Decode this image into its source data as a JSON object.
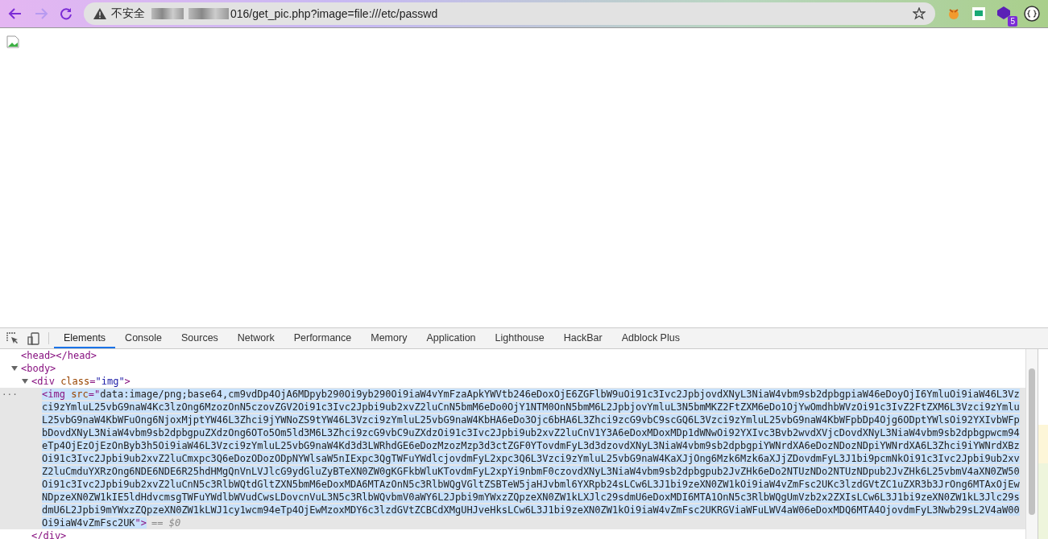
{
  "browser": {
    "security_label": "不安全",
    "url_visible": "016/get_pic.php?image=file:///etc/passwd",
    "extension_badge": "5"
  },
  "devtools": {
    "tabs": [
      {
        "label": "Elements",
        "selected": true
      },
      {
        "label": "Console",
        "selected": false
      },
      {
        "label": "Sources",
        "selected": false
      },
      {
        "label": "Network",
        "selected": false
      },
      {
        "label": "Performance",
        "selected": false
      },
      {
        "label": "Memory",
        "selected": false
      },
      {
        "label": "Application",
        "selected": false
      },
      {
        "label": "Lighthouse",
        "selected": false
      },
      {
        "label": "HackBar",
        "selected": false
      },
      {
        "label": "Adblock Plus",
        "selected": false
      }
    ],
    "dom_tree": [
      {
        "selected": false,
        "segments": [
          {
            "kind": "tag",
            "text": "<head></head>"
          }
        ]
      },
      {
        "selected": false,
        "expanded": true,
        "segments": [
          {
            "kind": "tag",
            "text": "<body>"
          }
        ],
        "children": [
          {
            "selected": false,
            "expanded": true,
            "segments": [
              {
                "kind": "tag",
                "text": "<div "
              },
              {
                "kind": "attr",
                "text": "class"
              },
              {
                "kind": "tag",
                "text": "="
              },
              {
                "kind": "value",
                "text": "\"img\""
              },
              {
                "kind": "tag",
                "text": ">"
              }
            ],
            "closing": "</div>",
            "children": [
              {
                "selected": true,
                "gutter": "...",
                "segments": [
                  {
                    "kind": "tag",
                    "text": "<img "
                  },
                  {
                    "kind": "attr",
                    "text": "src"
                  },
                  {
                    "kind": "tag",
                    "text": "=\""
                  },
                  {
                    "kind": "value",
                    "text": "data:image/png;base64,cm9vdDp4OjA6MDpyb290Oi9yb290Oi9iaW4vYmFzaApkYWVtb246eDoxOjE6ZGFlbW9uOi91c3Ivc2JpbjovdXNyL3NiaW4vbm9sb2dpbgpiaW46eDoyOjI6YmluOi9iaW46L3Vzci9zYmluL25vbG9naW4Kc3lzOng6MzozOnN5czovZGV2Oi91c3Ivc2Jpbi9ub2xvZ2luCnN5bmM6eDo0OjY1NTM0OnN5bmM6L2JpbjovYmluL3N5bmMKZ2FtZXM6eDo1OjYwOmdhbWVzOi91c3IvZ2FtZXM6L3Vzci9zYmluL25vbG9naW4KbWFuOng6NjoxMjptYW46L3Zhci9jYWNoZS9tYW46L3Vzci9zYmluL25vbG9naW4KbHA6eDo3Ojc6bHA6L3Zhci9zcG9vbC9scGQ6L3Vzci9zYmluL25vbG9naW4KbWFpbDp4Ojg6ODptYWlsOi92YXIvbWFpbDovdXNyL3NiaW4vbm9sb2dpbgpuZXdzOng6OTo5Om5ld3M6L3Zhci9zcG9vbC9uZXdzOi91c3Ivc2Jpbi9ub2xvZ2luCnV1Y3A6eDoxMDoxMDp1dWNwOi92YXIvc3Bvb2wvdXVjcDovdXNyL3NiaW4vbm9sb2dpbgpwcm94eTp4OjEzOjEzOnByb3h5Oi9iaW46L3Vzci9zYmluL25vbG9naW4Kd3d3LWRhdGE6eDozMzozMzp3d3ctZGF0YTovdmFyL3d3dzovdXNyL3NiaW4vbm9sb2dpbgpiYWNrdXA6eDozNDozNDpiYWNrdXA6L3Zhci9iYWNrdXBzOi91c3Ivc2Jpbi9ub2xvZ2luCmxpc3Q6eDozODozODpNYWlsaW5nIExpc3QgTWFuYWdlcjovdmFyL2xpc3Q6L3Vzci9zYmluL25vbG9naW4KaXJjOng6Mzk6Mzk6aXJjZDovdmFyL3J1bi9pcmNkOi91c3Ivc2Jpbi9ub2xvZ2luCmduYXRzOng6NDE6NDE6R25hdHMgQnVnLVJlcG9ydGluZyBTeXN0ZW0gKGFkbWluKTovdmFyL2xpYi9nbmF0czovdXNyL3NiaW4vbm9sb2dpbgpub2JvZHk6eDo2NTUzNDo2NTUzNDpub2JvZHk6L25vbmV4aXN0ZW50Oi91c3Ivc2Jpbi9ub2xvZ2luCnN5c3RlbWQtdGltZXN5bmM6eDoxMDA6MTAzOnN5c3RlbWQgVGltZSBTeW5jaHJvbml6YXRpb24sLCw6L3J1bi9zeXN0ZW1kOi9iaW4vZmFsc2UKc3lzdGVtZC1uZXR3b3JrOng6MTAxOjEwNDpzeXN0ZW1kIE5ldHdvcmsgTWFuYWdlbWVudCwsLDovcnVuL3N5c3RlbWQvbmV0aWY6L2Jpbi9mYWxzZQpzeXN0ZW1kLXJlc29sdmU6eDoxMDI6MTA1OnN5c3RlbWQgUmVzb2x2ZXIsLCw6L3J1bi9zeXN0ZW1kL3Jlc29sdmU6L2Jpbi9mYWxzZQpzeXN0ZW1kLWJ1cy1wcm94eTp4OjEwMzoxMDY6c3lzdGVtZCBCdXMgUHJveHksLCw6L3J1bi9zeXN0ZW1kOi9iaW4vZmFsc2UKRGViaWFuLWV4aW06eDoxMDQ6MTA4OjovdmFyL3Nwb29sL2V4aW00Oi9iaW4vZmFsc2UK"
                  },
                  {
                    "kind": "tag",
                    "text": "\">"
                  },
                  {
                    "kind": "note",
                    "text": "== $0"
                  }
                ]
              }
            ]
          }
        ]
      }
    ]
  }
}
